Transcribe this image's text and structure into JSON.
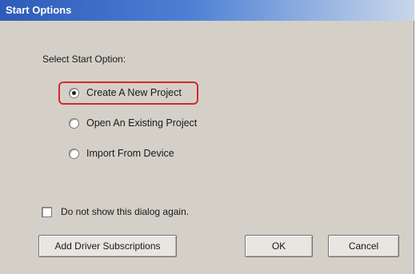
{
  "window": {
    "title": "Start Options"
  },
  "start_options": {
    "group_label": "Select Start Option:",
    "options": [
      {
        "label": "Create A New Project",
        "selected": true
      },
      {
        "label": "Open An Existing Project",
        "selected": false
      },
      {
        "label": "Import From Device",
        "selected": false
      }
    ]
  },
  "dont_show_again": {
    "label": "Do not show this dialog again.",
    "checked": false
  },
  "buttons": {
    "add_driver": "Add Driver Subscriptions",
    "ok": "OK",
    "cancel": "Cancel"
  },
  "colors": {
    "titlebar": "#2d5bb7",
    "dialog_bg": "#d4d0c8",
    "highlight": "#d42a2a"
  }
}
